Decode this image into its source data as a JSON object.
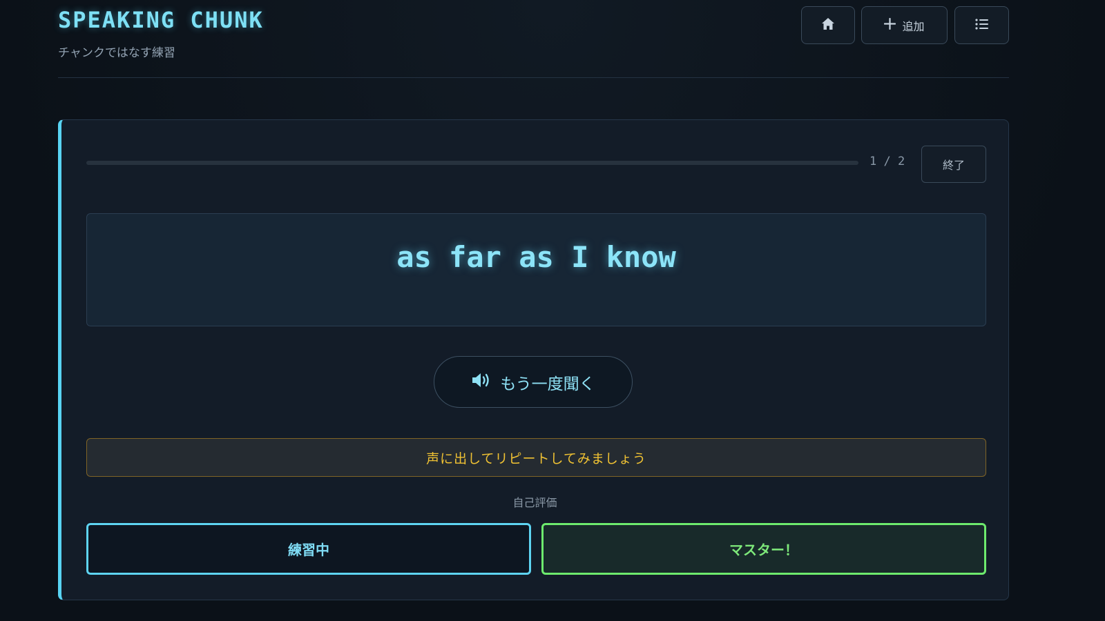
{
  "header": {
    "title": "SPEAKING CHUNK",
    "subtitle": "チャンクではなす練習",
    "nav": {
      "home_icon": "home-icon",
      "add_label": "追加",
      "add_icon": "plus-icon",
      "list_icon": "list-icon"
    }
  },
  "practice": {
    "progress": {
      "current": 1,
      "total": 2,
      "label": "1 / 2",
      "fill_fraction": 0.0
    },
    "finish_label": "終了",
    "chunk": "as far as I know",
    "listen_again_label": "もう一度聞く",
    "listen_icon": "speaker-icon",
    "hint": "声に出してリピートしてみましょう",
    "self_eval_label": "自己評価",
    "rating": {
      "practicing_label": "練習中",
      "master_label": "マスター！"
    }
  },
  "colors": {
    "accent": "#58d3f2",
    "warning": "#f0c233",
    "success": "#6dea6d",
    "background": "#0c1219"
  }
}
